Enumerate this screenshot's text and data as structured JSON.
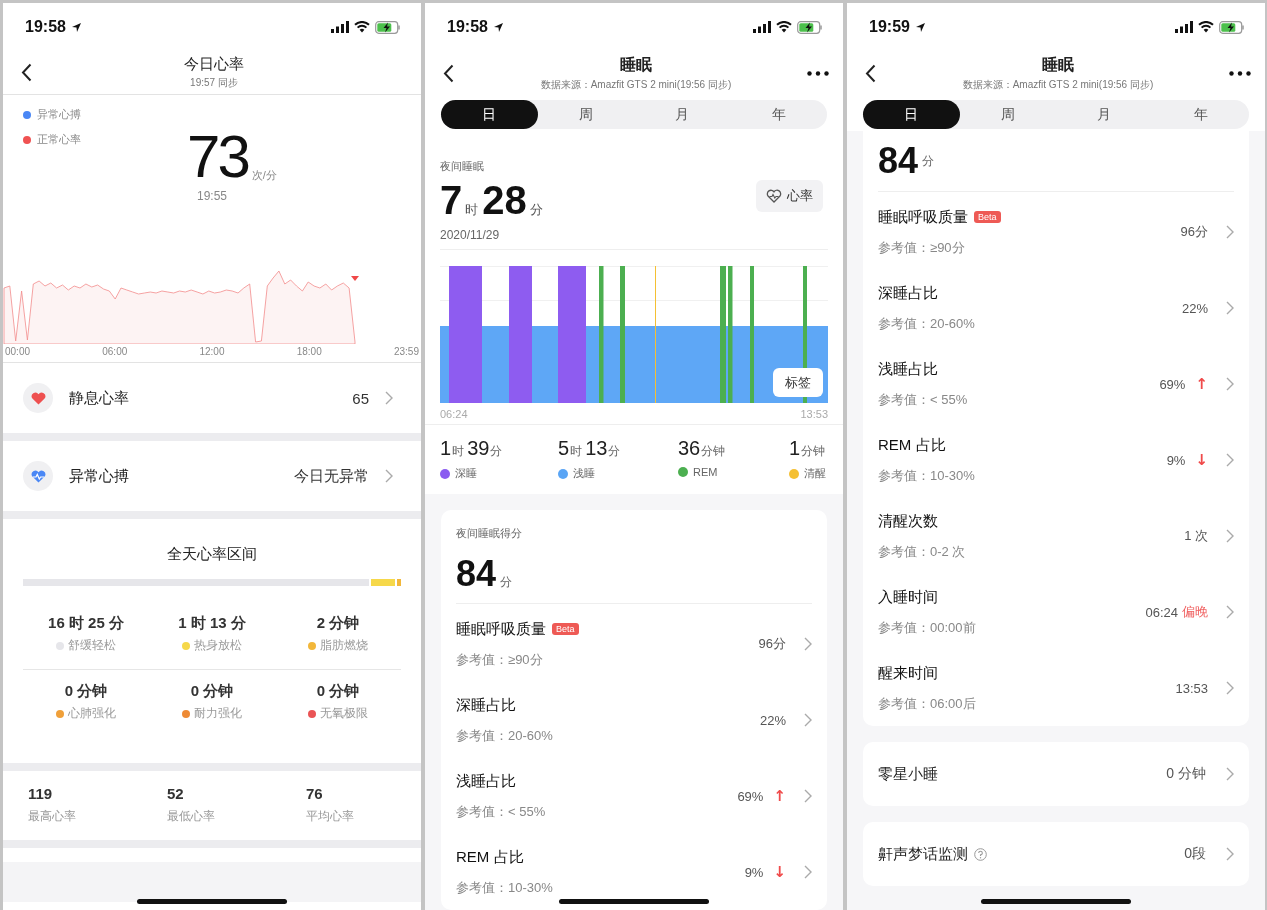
{
  "screens": [
    {
      "kind": "heart_rate",
      "status_bar": {
        "time": "19:58"
      },
      "nav": {
        "title": "今日心率",
        "subtitle": "19:57 同步"
      },
      "legend": [
        {
          "label": "异常心搏",
          "color": "#4a87f5"
        },
        {
          "label": "正常心率",
          "color": "#f05252"
        }
      ],
      "current": {
        "value": "73",
        "unit": "次/分",
        "time": "19:55"
      },
      "chart_axis": [
        "00:00",
        "06:00",
        "12:00",
        "18:00",
        "23:59"
      ],
      "rows": [
        {
          "kind": "resting",
          "label": "静息心率",
          "value": "65"
        },
        {
          "kind": "abnormal",
          "label": "异常心搏",
          "value": "今日无异常"
        }
      ],
      "zones": {
        "title": "全天心率区间",
        "items": [
          {
            "value": "16 时 25 分",
            "label": "舒缓轻松",
            "color": "#e6e6ea",
            "level": 0.915
          },
          {
            "value": "1 时 13 分",
            "label": "热身放松",
            "color": "#f6d84a",
            "level": 0.07
          },
          {
            "value": "2 分钟",
            "label": "脂肪燃烧",
            "color": "#f2b73a",
            "level": 0.015
          },
          {
            "value": "0 分钟",
            "label": "心肺强化",
            "color": "#f0a03a"
          },
          {
            "value": "0 分钟",
            "label": "耐力强化",
            "color": "#ee8a35"
          },
          {
            "value": "0 分钟",
            "label": "无氧极限",
            "color": "#ea5455"
          }
        ]
      },
      "stats": [
        {
          "value": "119",
          "label": "最高心率"
        },
        {
          "value": "52",
          "label": "最低心率"
        },
        {
          "value": "76",
          "label": "平均心率"
        }
      ]
    },
    {
      "kind": "sleep",
      "status_bar": {
        "time": "19:58"
      },
      "nav": {
        "title": "睡眠",
        "subtitle": "数据来源：Amazfit GTS 2 mini(19:56 同步)"
      },
      "tabs": [
        {
          "label": "日",
          "selected": true
        },
        {
          "label": "周",
          "selected": false
        },
        {
          "label": "月",
          "selected": false
        },
        {
          "label": "年",
          "selected": false
        }
      ],
      "summary": {
        "label": "夜间睡眠",
        "duration": [
          {
            "number": "7",
            "unit": "时"
          },
          {
            "number": "28",
            "unit": "分"
          }
        ],
        "button": "心率",
        "date": "2020/11/29",
        "chart_start": "06:24",
        "chart_end": "13:53",
        "tag_button": "标签",
        "stages": [
          {
            "amount": [
              {
                "number": "1",
                "unit": "时"
              },
              {
                "number": "39",
                "unit": "分"
              }
            ],
            "label": "深睡",
            "color": "#8b5cf0"
          },
          {
            "amount": [
              {
                "number": "5",
                "unit": "时"
              },
              {
                "number": "13",
                "unit": "分"
              }
            ],
            "label": "浅睡",
            "color": "#5aa5f5"
          },
          {
            "amount": [
              {
                "number": "36",
                "unit": "分钟"
              }
            ],
            "label": "REM",
            "color": "#4caf50"
          },
          {
            "amount": [
              {
                "number": "1",
                "unit": "分钟"
              }
            ],
            "label": "清醒",
            "color": "#f5c033"
          }
        ]
      },
      "score": {
        "label": "夜间睡眠得分",
        "value": "84",
        "unit": "分"
      },
      "metrics": [
        {
          "title": "睡眠呼吸质量",
          "badge": "Beta",
          "reference": "参考值：≥90分",
          "value": "96分"
        },
        {
          "title": "深睡占比",
          "reference": "参考值：20-60%",
          "value": "22%"
        },
        {
          "title": "浅睡占比",
          "reference": "参考值：< 55%",
          "value": "69%",
          "trend": "↑"
        },
        {
          "title": "REM 占比",
          "reference": "参考值：10-30%",
          "value": "9%",
          "trend": "↓"
        }
      ]
    },
    {
      "kind": "sleep",
      "status_bar": {
        "time": "19:59"
      },
      "nav": {
        "title": "睡眠",
        "subtitle": "数据来源：Amazfit GTS 2 mini(19:56 同步)"
      },
      "tabs": [
        {
          "label": "日",
          "selected": true
        },
        {
          "label": "周",
          "selected": false
        },
        {
          "label": "月",
          "selected": false
        },
        {
          "label": "年",
          "selected": false
        }
      ],
      "score": {
        "value": "84",
        "unit": "分"
      },
      "metrics": [
        {
          "title": "睡眠呼吸质量",
          "badge": "Beta",
          "reference": "参考值：≥90分",
          "value": "96分"
        },
        {
          "title": "深睡占比",
          "reference": "参考值：20-60%",
          "value": "22%"
        },
        {
          "title": "浅睡占比",
          "reference": "参考值：< 55%",
          "value": "69%",
          "trend": "↑"
        },
        {
          "title": "REM 占比",
          "reference": "参考值：10-30%",
          "value": "9%",
          "trend": "↓"
        },
        {
          "title": "清醒次数",
          "reference": "参考值：0-2 次",
          "value": "1 次"
        },
        {
          "title": "入睡时间",
          "reference": "参考值：00:00前",
          "value": "06:24",
          "flag": "偏晚"
        },
        {
          "title": "醒来时间",
          "reference": "参考值：06:00后",
          "value": "13:53"
        }
      ],
      "cards": [
        {
          "label": "零星小睡",
          "value": "0 分钟"
        },
        {
          "label": "鼾声梦话监测",
          "value": "0段",
          "help": true
        }
      ]
    }
  ]
}
